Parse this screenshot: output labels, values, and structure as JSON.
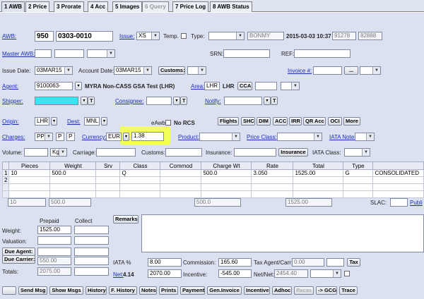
{
  "tabs": [
    {
      "label": "1 AWB"
    },
    {
      "label": "2 Price"
    },
    {
      "label": "3 Prorate"
    },
    {
      "label": "4 Acc"
    },
    {
      "label": "5 Images"
    },
    {
      "label": "6 Query"
    },
    {
      "label": "7 Price Log"
    },
    {
      "label": "8 AWB Status"
    }
  ],
  "awb": {
    "label": "AWB:",
    "prefix": "950",
    "number": "0303-0010",
    "issue_label": "Issue:",
    "issue_value": "XS",
    "temp_label": "Temp.",
    "type_label": "Type:",
    "type_value": "",
    "bonmy": "BONMY",
    "datetime": "2015-03-03 10:37",
    "num1": "91278",
    "num2": "82888"
  },
  "master": {
    "label": "Master AWB:",
    "srn_label": "SRN:",
    "ref_label": "REF:"
  },
  "issue_date": {
    "label": "Issue Date:",
    "value": "03MAR15",
    "account_label": "Account Date:",
    "account_value": "03MAR15",
    "customs_btn": "Customs:",
    "invoice_label": "Invoice #:",
    "invoice_btn": "..."
  },
  "agent": {
    "label": "Agent:",
    "code": "9100063-",
    "name": "MYRA Non-CASS GSA Test (LHR)",
    "area_label": "Area:",
    "area_value": "LHR",
    "area_text": "LHR",
    "cca_btn": "CCA"
  },
  "parties": {
    "shipper": "Shipper:",
    "consignee": "Consignee:",
    "notify": "Notify:",
    "t": "T"
  },
  "route": {
    "origin_label": "Origin:",
    "origin_value": "LHR",
    "dest_label": "Dest:",
    "dest_value": "MNL",
    "eawb": "eAwb",
    "norcs": "No RCS",
    "buttons": [
      "Flights",
      "SHC",
      "DIM",
      "ACC",
      "IRR",
      "QR Acc",
      "OCI",
      "More"
    ]
  },
  "charges": {
    "label": "Charges:",
    "pp": "PP",
    "p1": "P",
    "p2": "P",
    "currency_label": "Currency:",
    "currency_value": "EUR",
    "rate": "1.38",
    "product_label": "Product:",
    "price_class_label": "Price Class:",
    "iata_note_label": "IATA Note:"
  },
  "volume": {
    "label": "Volume:",
    "unit": "Kg",
    "carriage": "Carriage:",
    "customs": "Customs:",
    "insurance": "Insurance:",
    "insurance_btn": "Insurance",
    "iata_class": "IATA Class:"
  },
  "table": {
    "headers": [
      "Pieces",
      "Weight",
      "Srv",
      "Class",
      "Commod",
      "Charge Wt",
      "Rate",
      "Total",
      "Type"
    ],
    "rows": [
      {
        "n": "1",
        "pieces": "10",
        "weight": "500.0",
        "srv": "",
        "class": "Q",
        "commod": "",
        "chargewt": "500.0",
        "rate": "3.050",
        "total": "1525.00",
        "type": "G",
        "desc": "CONSOLIDATED"
      },
      {
        "n": "2",
        "pieces": "",
        "weight": "",
        "srv": "",
        "class": "",
        "commod": "",
        "chargewt": "",
        "rate": "",
        "total": "",
        "type": "",
        "desc": ""
      }
    ],
    "totals": {
      "pieces": "10",
      "weight": "500.0",
      "chargewt": "500.0",
      "total": "1525.00",
      "slac": "SLAC:",
      "publ": "Publi"
    }
  },
  "summary": {
    "prepaid": "Prepaid",
    "collect": "Collect",
    "remarks_btn": "Remarks",
    "weight_label": "Weight:",
    "weight_prepaid": "1525.00",
    "valuation_label": "Valuation:",
    "due_agent": "Due Agent:",
    "due_carrier": "Due Carrier:",
    "due_carrier_value": "550.00",
    "totals_label": "Totals:",
    "totals_value": "2075.00",
    "iata_label": "IATA %",
    "iata_value": "8.00",
    "net_label": "Net:",
    "net_value": "4.14",
    "net_input": "2070.00",
    "commission_label": "Commission:",
    "commission_value": "165.60",
    "tax_label": "Tax Agent/Carr:",
    "tax_value": "0.00",
    "tax_btn": "Tax",
    "incentive_label": "Incentive:",
    "incentive_value": "-545.00",
    "netnet_label": "Net/Net:",
    "netnet_value": "2454.40"
  },
  "bottom_buttons": [
    "Send Msg",
    "Show Msgs",
    "History",
    "F. History",
    "Notes",
    "Prints",
    "Payment",
    "Gen.Invoice",
    "Incentive",
    "Adhoc",
    "Racas",
    "-> GCG",
    "Trace"
  ]
}
